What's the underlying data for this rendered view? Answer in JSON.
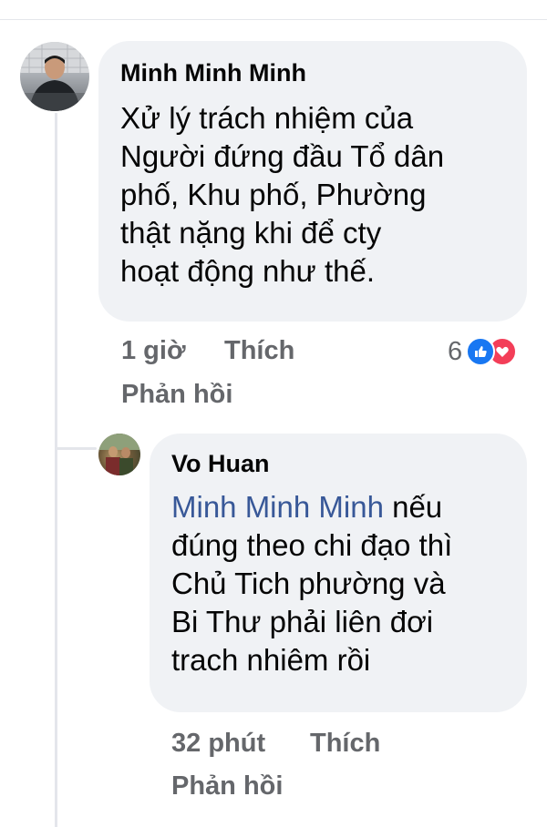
{
  "comment": {
    "author": "Minh Minh Minh",
    "lines": [
      "Xử lý trách nhiệm của",
      "Người đứng đầu Tổ dân",
      "phố, Khu phố, Phường",
      "thật nặng khi để cty",
      "hoạt động như thế."
    ],
    "time": "1 giờ",
    "like_label": "Thích",
    "reply_label": "Phản hồi",
    "reaction_count": "6",
    "reactions": [
      "like-icon",
      "love-icon"
    ]
  },
  "reply": {
    "author": "Vo Huan",
    "mention": "Minh Minh Minh",
    "first_line_rest": " nếu",
    "lines": [
      "đúng theo chi đạo thì",
      "Chủ Tich phường và",
      "Bi Thư phải liên đơi",
      "trach nhiêm rồi"
    ],
    "time": "32 phút",
    "like_label": "Thích",
    "reply_label": "Phản hồi"
  },
  "colors": {
    "bubble": "#f0f2f5",
    "text": "#050505",
    "meta": "#65676b",
    "mention": "#385898",
    "like": "#1877f2",
    "love": "#f33e58"
  }
}
